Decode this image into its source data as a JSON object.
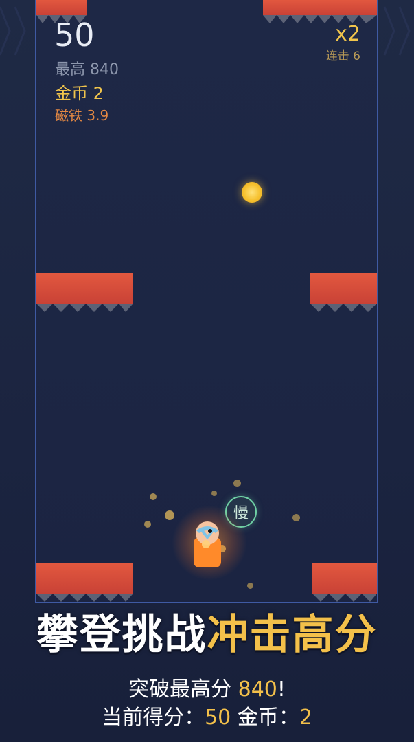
{
  "hud": {
    "score": "50",
    "best_label": "最高 840",
    "coins_label": "金币 2",
    "magnet_label": "磁铁 3.9",
    "multiplier": "x2",
    "combo_label": "连击 6"
  },
  "powerup": {
    "slow_label": "慢"
  },
  "promo": {
    "headline_white": "攀登挑战",
    "headline_gold": "冲击高分",
    "line1_prefix": "突破最高分 ",
    "line1_value": "840",
    "line1_suffix": "!",
    "line2_score_label": "当前得分：",
    "line2_score_value": "50",
    "line2_coins_label": "金币：",
    "line2_coins_value": "2"
  },
  "colors": {
    "wall": "#e2583f",
    "accent_gold": "#f3c04a",
    "arena_border": "#3f5aa3",
    "slow_ring": "#6fd0a5",
    "player": "#ff8a2a"
  }
}
